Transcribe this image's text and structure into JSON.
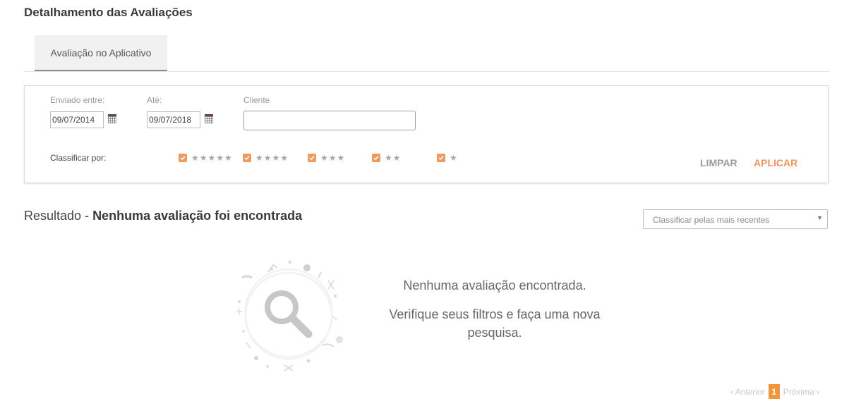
{
  "header": {
    "title": "Detalhamento das Avaliações"
  },
  "tabs": [
    {
      "label": "Avaliação no Aplicativo"
    }
  ],
  "filters": {
    "sent_between_label": "Enviado entre:",
    "until_label": "Até:",
    "client_label": "Cliente",
    "date_from": "09/07/2014",
    "date_to": "09/07/2018",
    "client_value": "",
    "sort_by_label": "Classificar por:",
    "star_options": [
      {
        "stars": "★★★★★",
        "checked": true
      },
      {
        "stars": "★★★★",
        "checked": true
      },
      {
        "stars": "★★★",
        "checked": true
      },
      {
        "stars": "★★",
        "checked": true
      },
      {
        "stars": "★",
        "checked": true
      }
    ],
    "clear_label": "LIMPAR",
    "apply_label": "APLICAR"
  },
  "result": {
    "prefix": "Resultado - ",
    "status": "Nenhuma avaliação foi encontrada",
    "sort_select": "Classificar pelas mais recentes"
  },
  "empty_state": {
    "line1": "Nenhuma avaliação encontrada.",
    "line2": "Verifique seus filtros e faça uma nova pesquisa."
  },
  "pagination": {
    "prev_label": "‹ Anterior",
    "current_page": "1",
    "next_label": "Próxima ›"
  },
  "colors": {
    "accent": "#f0935a",
    "page_badge": "#f0963f"
  }
}
